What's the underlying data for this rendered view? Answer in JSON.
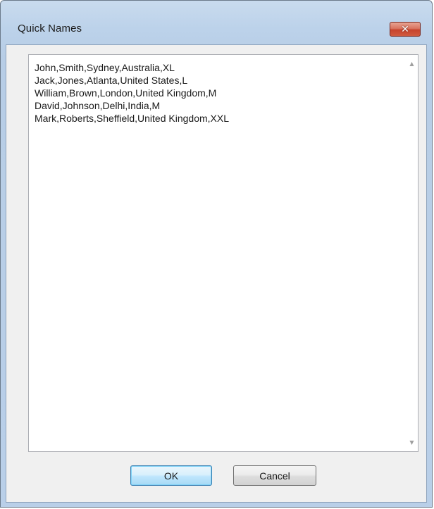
{
  "window": {
    "title": "Quick Names",
    "close_glyph": "✕"
  },
  "textarea": {
    "value": "John,Smith,Sydney,Australia,XL\nJack,Jones,Atlanta,United States,L\nWilliam,Brown,London,United Kingdom,M\nDavid,Johnson,Delhi,India,M\nMark,Roberts,Sheffield,United Kingdom,XXL"
  },
  "buttons": {
    "ok_label": "OK",
    "cancel_label": "Cancel"
  },
  "icons": {
    "close": "close-icon",
    "scroll_up": "scroll-up-arrow-icon",
    "scroll_down": "scroll-down-arrow-icon"
  },
  "colors": {
    "close_button": "#c7432d",
    "ok_focus": "#3c7fb1"
  }
}
